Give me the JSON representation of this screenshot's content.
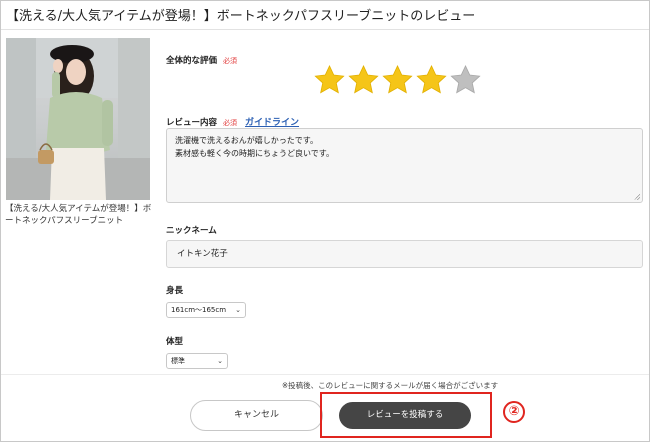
{
  "page": {
    "title": "【洗える/大人気アイテムが登場！】ボートネックパフスリーブニットのレビュー"
  },
  "product": {
    "name": "【洗える/大人気アイテムが登場！】ボートネックパフスリーブニット"
  },
  "rating": {
    "label": "全体的な評価",
    "required": "必須",
    "value": 4,
    "max": 5,
    "filled_color": "#f5c518",
    "empty_color": "#bfbfbf"
  },
  "review": {
    "label": "レビュー内容",
    "required": "必須",
    "guideline_link": "ガイドライン",
    "lines": [
      "洗濯機で洗えるおんが嬉しかったです。",
      "素材感も軽く今の時期にちょうど良いです。"
    ]
  },
  "nickname": {
    "label": "ニックネーム",
    "value": "イトキン花子"
  },
  "height": {
    "label": "身長",
    "value": "161cm～165cm"
  },
  "body_type": {
    "label": "体型",
    "value": "標準"
  },
  "footer": {
    "notice": "※投稿後、このレビューに関するメールが届く場合がございます",
    "cancel_label": "キャンセル",
    "submit_label": "レビューを投稿する"
  },
  "annotation": {
    "step": "②",
    "color": "#e0251f"
  }
}
